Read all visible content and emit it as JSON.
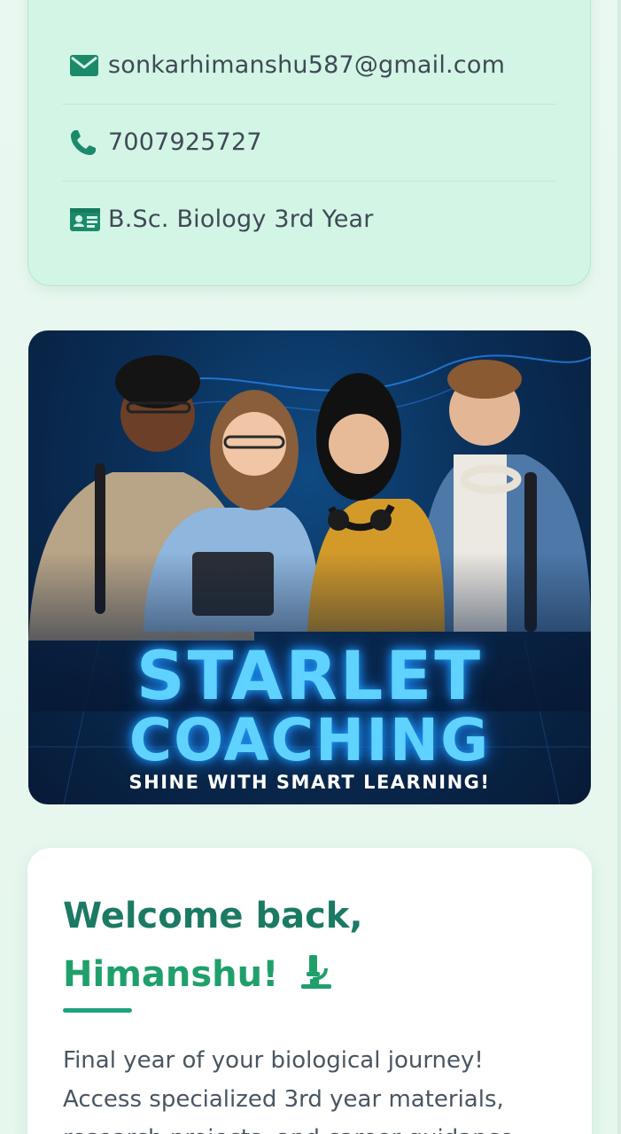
{
  "contact": {
    "email": "sonkarhimanshu587@gmail.com",
    "phone": "7007925727",
    "course": "B.Sc. Biology 3rd Year"
  },
  "banner": {
    "title_line1": "STARLET",
    "title_line2": "COACHING",
    "tagline": "SHINE WITH SMART LEARNING!"
  },
  "welcome": {
    "greeting": "Welcome back,",
    "name": "Himanshu!",
    "message": "Final year of your biological journey! Access specialized 3rd year materials, research projects, and career guidance"
  },
  "colors": {
    "brand_green": "#1b7a63",
    "accent_green": "#1fa06b",
    "card_mint": "#d3f5e5",
    "banner_glow": "#5fd2ff"
  },
  "icons": {
    "email": "envelope-icon",
    "phone": "phone-icon",
    "course": "id-card-icon",
    "welcome": "microscope-icon"
  }
}
